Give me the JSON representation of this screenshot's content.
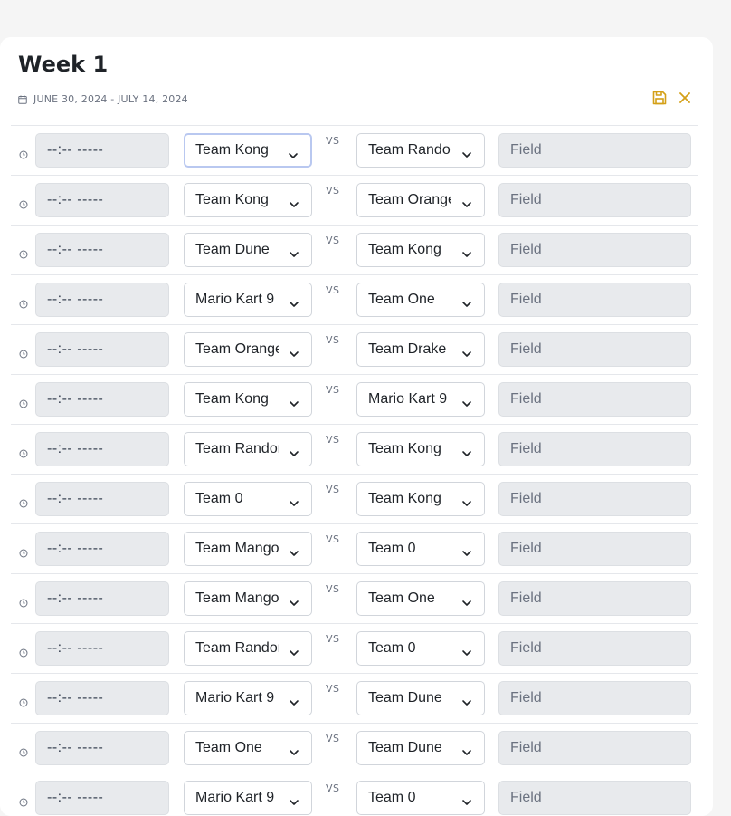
{
  "week": {
    "title": "Week 1",
    "date_range": "JUNE 30, 2024 - JULY 14, 2024"
  },
  "colors": {
    "accent": "#d4a017",
    "input_bg": "#e8eaed",
    "divider": "#e5e7eb"
  },
  "icons": {
    "calendar": "calendar-icon",
    "save": "save-icon",
    "close": "close-icon",
    "clock": "clock-icon",
    "chevron": "chevron-down-icon"
  },
  "vs_label": "VS",
  "matches": [
    {
      "time": "--:-- -----",
      "team_a": "Team Kong",
      "team_b": "Team Random",
      "field_placeholder": "Field"
    },
    {
      "time": "--:-- -----",
      "team_a": "Team Kong",
      "team_b": "Team Orange",
      "field_placeholder": "Field"
    },
    {
      "time": "--:-- -----",
      "team_a": "Team Dune",
      "team_b": "Team Kong",
      "field_placeholder": "Field"
    },
    {
      "time": "--:-- -----",
      "team_a": "Mario Kart 9",
      "team_b": "Team One",
      "field_placeholder": "Field"
    },
    {
      "time": "--:-- -----",
      "team_a": "Team Orange",
      "team_b": "Team Drake",
      "field_placeholder": "Field"
    },
    {
      "time": "--:-- -----",
      "team_a": "Team Kong",
      "team_b": "Mario Kart 9",
      "field_placeholder": "Field"
    },
    {
      "time": "--:-- -----",
      "team_a": "Team Random",
      "team_b": "Team Kong",
      "field_placeholder": "Field"
    },
    {
      "time": "--:-- -----",
      "team_a": "Team 0",
      "team_b": "Team Kong",
      "field_placeholder": "Field"
    },
    {
      "time": "--:-- -----",
      "team_a": "Team Mango",
      "team_b": "Team 0",
      "field_placeholder": "Field"
    },
    {
      "time": "--:-- -----",
      "team_a": "Team Mango",
      "team_b": "Team One",
      "field_placeholder": "Field"
    },
    {
      "time": "--:-- -----",
      "team_a": "Team Random",
      "team_b": "Team 0",
      "field_placeholder": "Field"
    },
    {
      "time": "--:-- -----",
      "team_a": "Mario Kart 9",
      "team_b": "Team Dune",
      "field_placeholder": "Field"
    },
    {
      "time": "--:-- -----",
      "team_a": "Team One",
      "team_b": "Team Dune",
      "field_placeholder": "Field"
    },
    {
      "time": "--:-- -----",
      "team_a": "Mario Kart 9",
      "team_b": "Team 0",
      "field_placeholder": "Field"
    }
  ]
}
